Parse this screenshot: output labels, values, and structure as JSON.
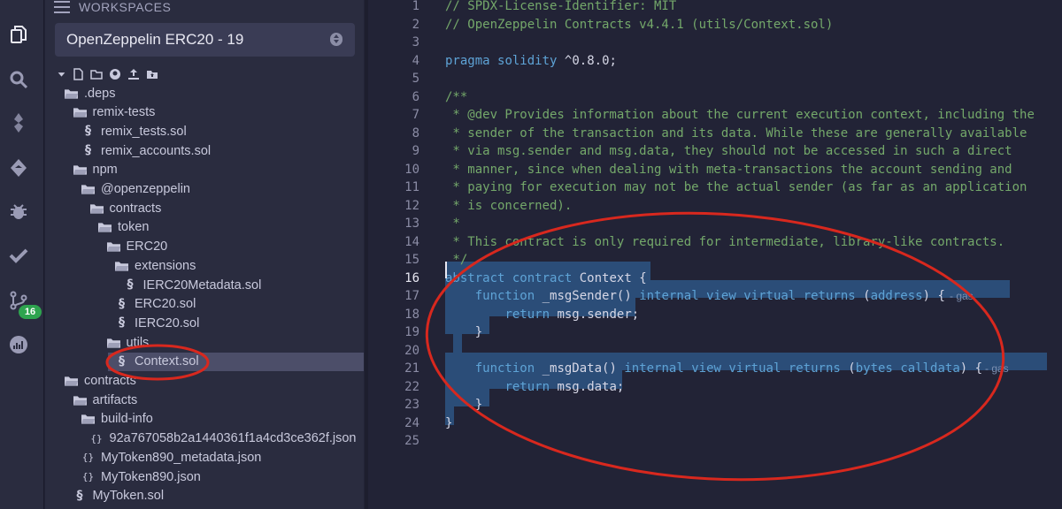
{
  "rail": {
    "badge_count": "16",
    "icons": [
      "file-explorer-icon",
      "search-icon",
      "solidity-compiler-icon",
      "deploy-run-icon",
      "debugger-icon",
      "unit-testing-icon",
      "git-icon",
      "analytics-icon"
    ]
  },
  "explorer": {
    "header": "WORKSPACES",
    "workspace_selected": "OpenZeppelin ERC20 - 19",
    "tree": [
      {
        "label": ".deps",
        "type": "folder",
        "depth": 0
      },
      {
        "label": "remix-tests",
        "type": "folder",
        "depth": 1
      },
      {
        "label": "remix_tests.sol",
        "type": "sol",
        "depth": 2
      },
      {
        "label": "remix_accounts.sol",
        "type": "sol",
        "depth": 2
      },
      {
        "label": "npm",
        "type": "folder",
        "depth": 1
      },
      {
        "label": "@openzeppelin",
        "type": "folder",
        "depth": 2
      },
      {
        "label": "contracts",
        "type": "folder",
        "depth": 3
      },
      {
        "label": "token",
        "type": "folder",
        "depth": 4
      },
      {
        "label": "ERC20",
        "type": "folder",
        "depth": 5
      },
      {
        "label": "extensions",
        "type": "folder",
        "depth": 6
      },
      {
        "label": "IERC20Metadata.sol",
        "type": "sol",
        "depth": 7
      },
      {
        "label": "ERC20.sol",
        "type": "sol",
        "depth": 6
      },
      {
        "label": "IERC20.sol",
        "type": "sol",
        "depth": 6
      },
      {
        "label": "utils",
        "type": "folder",
        "depth": 5
      },
      {
        "label": "Context.sol",
        "type": "sol",
        "depth": 6,
        "selected": true
      },
      {
        "label": "contracts",
        "type": "folder",
        "depth": 0
      },
      {
        "label": "artifacts",
        "type": "folder",
        "depth": 1
      },
      {
        "label": "build-info",
        "type": "folder",
        "depth": 2
      },
      {
        "label": "92a767058b2a1440361f1a4cd3ce362f.json",
        "type": "json",
        "depth": 3
      },
      {
        "label": "MyToken890_metadata.json",
        "type": "json",
        "depth": 2
      },
      {
        "label": "MyToken890.json",
        "type": "json",
        "depth": 2
      },
      {
        "label": "MyToken.sol",
        "type": "sol",
        "depth": 1
      }
    ]
  },
  "editor": {
    "active_line": 16,
    "lines": [
      {
        "n": "1",
        "text": "// SPDX-License-Identifier: MIT"
      },
      {
        "n": "2",
        "text": "// OpenZeppelin Contracts v4.4.1 (utils/Context.sol)"
      },
      {
        "n": "3",
        "text": ""
      },
      {
        "n": "4",
        "text": "pragma solidity ^0.8.0;"
      },
      {
        "n": "5",
        "text": ""
      },
      {
        "n": "6",
        "text": "/**"
      },
      {
        "n": "7",
        "text": " * @dev Provides information about the current execution context, including the"
      },
      {
        "n": "8",
        "text": " * sender of the transaction and its data. While these are generally available"
      },
      {
        "n": "9",
        "text": " * via msg.sender and msg.data, they should not be accessed in such a direct"
      },
      {
        "n": "10",
        "text": " * manner, since when dealing with meta-transactions the account sending and"
      },
      {
        "n": "11",
        "text": " * paying for execution may not be the actual sender (as far as an application"
      },
      {
        "n": "12",
        "text": " * is concerned)."
      },
      {
        "n": "13",
        "text": " *"
      },
      {
        "n": "14",
        "text": " * This contract is only required for intermediate, library-like contracts."
      },
      {
        "n": "15",
        "text": " */"
      },
      {
        "n": "16",
        "text": "abstract contract Context {"
      },
      {
        "n": "17",
        "text": "    function _msgSender() internal view virtual returns (address) {"
      },
      {
        "n": "18",
        "text": "        return msg.sender;"
      },
      {
        "n": "19",
        "text": "    }"
      },
      {
        "n": "20",
        "text": ""
      },
      {
        "n": "21",
        "text": "    function _msgData() internal view virtual returns (bytes calldata) {"
      },
      {
        "n": "22",
        "text": "        return msg.data;"
      },
      {
        "n": "23",
        "text": "    }"
      },
      {
        "n": "24",
        "text": "}"
      },
      {
        "n": "25",
        "text": ""
      }
    ],
    "gas_hint_17": "- gas",
    "gas_hint_21": "- gas"
  },
  "colors": {
    "accent_annotation": "#d8281e",
    "selection": "#2b4d78",
    "comment": "#74a86a",
    "keyword": "#5ea3d6",
    "badge": "#2ea44f"
  }
}
